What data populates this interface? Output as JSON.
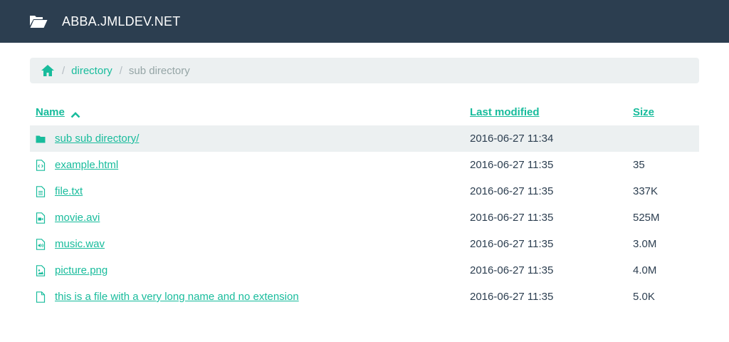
{
  "header": {
    "title": "ABBA.JMLDEV.NET",
    "logo_icon": "folder-open-icon"
  },
  "breadcrumb": {
    "home_icon": "home-icon",
    "items": [
      {
        "label": "directory",
        "link": true
      },
      {
        "label": "sub directory",
        "link": false
      }
    ]
  },
  "table": {
    "columns": {
      "name": "Name",
      "modified": "Last modified",
      "size": "Size"
    },
    "sort": {
      "column": "name",
      "direction": "ascending",
      "icon": "chevron-up-icon"
    },
    "rows": [
      {
        "name": "sub sub directory/",
        "icon": "folder-icon",
        "modified": "2016-06-27 11:34",
        "size": ""
      },
      {
        "name": "example.html",
        "icon": "file-code-icon",
        "modified": "2016-06-27 11:35",
        "size": "35"
      },
      {
        "name": "file.txt",
        "icon": "file-text-icon",
        "modified": "2016-06-27 11:35",
        "size": "337K"
      },
      {
        "name": "movie.avi",
        "icon": "file-video-icon",
        "modified": "2016-06-27 11:35",
        "size": "525M"
      },
      {
        "name": "music.wav",
        "icon": "file-audio-icon",
        "modified": "2016-06-27 11:35",
        "size": "3.0M"
      },
      {
        "name": "picture.png",
        "icon": "file-image-icon",
        "modified": "2016-06-27 11:35",
        "size": "4.0M"
      },
      {
        "name": "this is a file with a very long name and no extension",
        "icon": "file-icon",
        "modified": "2016-06-27 11:35",
        "size": "5.0K"
      }
    ]
  },
  "colors": {
    "navbar": "#2c3e50",
    "accent": "#18bc9c",
    "breadcrumb_bg": "#ecf0f1",
    "muted": "#95a5a6",
    "text": "#2c3e50"
  }
}
